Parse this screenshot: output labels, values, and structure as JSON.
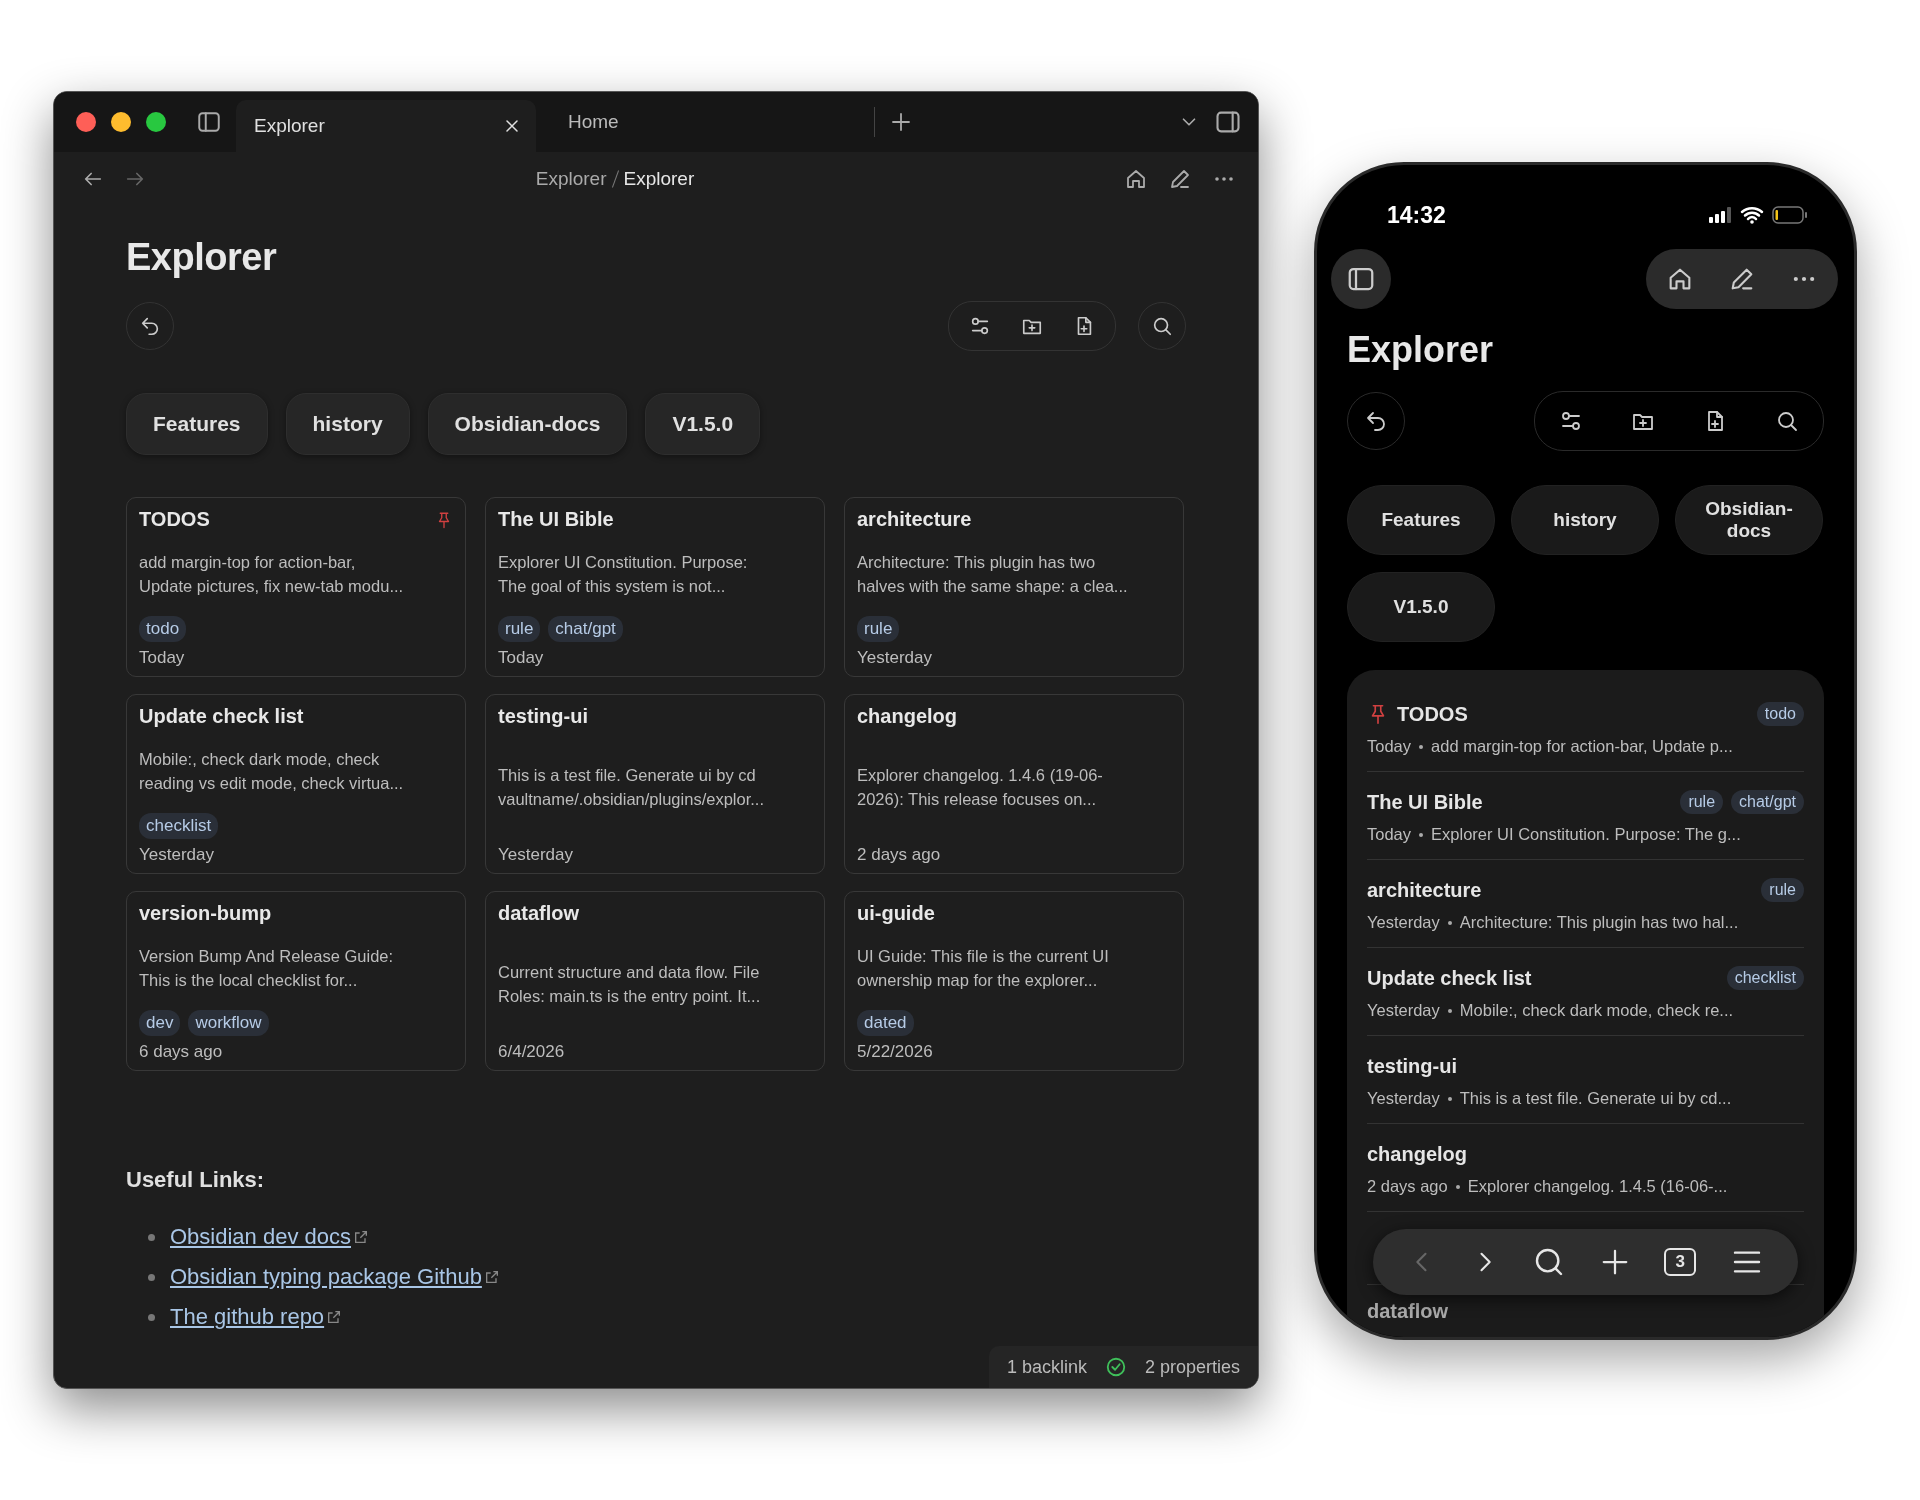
{
  "desktop": {
    "tabs": [
      {
        "label": "Explorer",
        "selected": true
      },
      {
        "label": "Home",
        "selected": false
      }
    ],
    "breadcrumb": [
      "Explorer",
      "Explorer"
    ],
    "title": "Explorer",
    "folders": [
      "Features",
      "history",
      "Obsidian-docs",
      "V1.5.0"
    ],
    "cards": [
      {
        "title": "TODOS",
        "pinned": true,
        "lines": [
          "add margin-top for action-bar,",
          "Update pictures, fix new-tab modu..."
        ],
        "tags": [
          "todo"
        ],
        "date": "Today"
      },
      {
        "title": "The UI Bible",
        "pinned": false,
        "lines": [
          "Explorer UI Constitution. Purpose:",
          "The goal of this system is not..."
        ],
        "tags": [
          "rule",
          "chat/gpt"
        ],
        "date": "Today"
      },
      {
        "title": "architecture",
        "pinned": false,
        "lines": [
          "Architecture: This plugin has two",
          "halves with the same shape: a clea..."
        ],
        "tags": [
          "rule"
        ],
        "date": "Yesterday"
      },
      {
        "title": "Update check list",
        "pinned": false,
        "lines": [
          "Mobile:, check dark mode, check",
          "reading vs edit mode, check virtua..."
        ],
        "tags": [
          "checklist"
        ],
        "date": "Yesterday"
      },
      {
        "title": "testing-ui",
        "pinned": false,
        "lines": [
          "This is a test file. Generate ui by cd",
          "vaultname/.obsidian/plugins/explor..."
        ],
        "date": "Yesterday"
      },
      {
        "title": "changelog",
        "pinned": false,
        "lines": [
          "Explorer changelog. 1.4.6 (19-06-",
          "2026): This release focuses on..."
        ],
        "date": "2 days ago"
      },
      {
        "title": "version-bump",
        "pinned": false,
        "lines": [
          "Version Bump And Release Guide:",
          "This is the local checklist for..."
        ],
        "tags": [
          "dev",
          "workflow"
        ],
        "date": "6 days ago"
      },
      {
        "title": "dataflow",
        "pinned": false,
        "lines": [
          "Current structure and data flow. File",
          "Roles: main.ts is the entry point. It..."
        ],
        "date": "6/4/2026"
      },
      {
        "title": "ui-guide",
        "pinned": false,
        "lines": [
          "UI Guide: This file is the current UI",
          "ownership map for the explorer..."
        ],
        "tags": [
          "dated"
        ],
        "date": "5/22/2026"
      }
    ],
    "links_heading": "Useful Links:",
    "links": [
      "Obsidian dev docs",
      "Obsidian typing package Github",
      "The github repo"
    ],
    "status": {
      "backlinks": "1 backlink",
      "properties": "2 properties"
    }
  },
  "phone": {
    "time": "14:32",
    "title": "Explorer",
    "folders": [
      "Features",
      "history",
      "Obsidian-docs",
      "V1.5.0"
    ],
    "rows": [
      {
        "title": "TODOS",
        "pinned": true,
        "date": "Today",
        "excerpt": "add margin-top for action-bar, Update p...",
        "tags": [
          "todo"
        ]
      },
      {
        "title": "The UI Bible",
        "pinned": false,
        "date": "Today",
        "excerpt": "Explorer UI Constitution. Purpose: The g...",
        "tags": [
          "rule",
          "chat/gpt"
        ]
      },
      {
        "title": "architecture",
        "pinned": false,
        "date": "Yesterday",
        "excerpt": "Architecture: This plugin has two hal...",
        "tags": [
          "rule"
        ]
      },
      {
        "title": "Update check list",
        "pinned": false,
        "date": "Yesterday",
        "excerpt": "Mobile:, check dark mode, check re...",
        "tags": [
          "checklist"
        ]
      },
      {
        "title": "testing-ui",
        "pinned": false,
        "date": "Yesterday",
        "excerpt": "This is a test file. Generate ui by cd..."
      },
      {
        "title": "changelog",
        "pinned": false,
        "date": "2 days ago",
        "excerpt": "Explorer changelog. 1.4.5 (16-06-..."
      }
    ],
    "last_row_title": "dataflow",
    "tab_count": "3"
  }
}
